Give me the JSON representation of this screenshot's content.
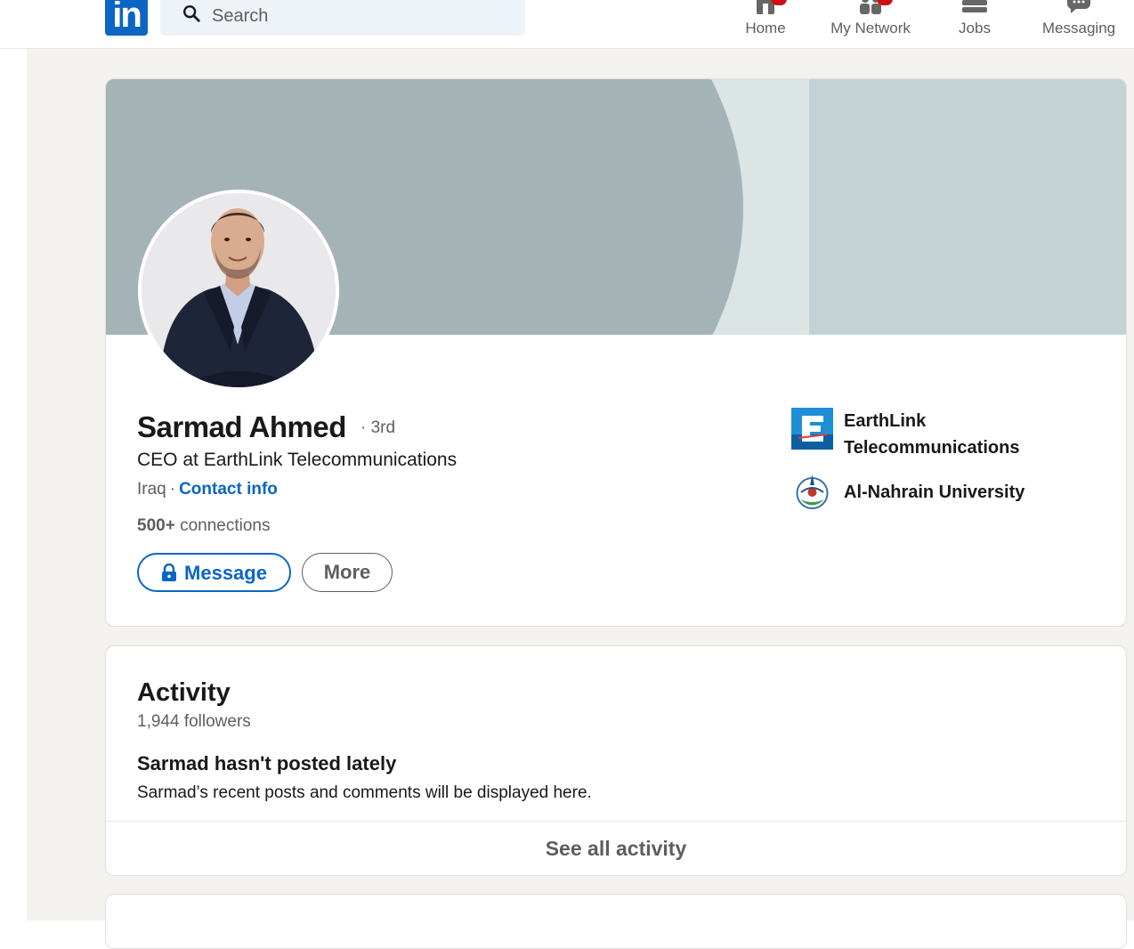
{
  "nav": {
    "logo_text": "in",
    "search_placeholder": "Search",
    "items": [
      {
        "label": "Home",
        "icon": "home-icon"
      },
      {
        "label": "My Network",
        "icon": "network-icon"
      },
      {
        "label": "Jobs",
        "icon": "briefcase-icon"
      },
      {
        "label": "Messaging",
        "icon": "chat-icon"
      }
    ]
  },
  "profile": {
    "name": "Sarmad Ahmed",
    "degree": "· 3rd",
    "headline": "CEO at EarthLink Telecommunications",
    "location": "Iraq",
    "separator": "·",
    "contact_info": "Contact info",
    "connections_count": "500+",
    "connections_label": "connections",
    "message_button": "Message",
    "more_button": "More",
    "organizations": [
      {
        "name": "EarthLink Telecommunications",
        "icon": "earthlink-logo"
      },
      {
        "name": "Al-Nahrain University",
        "icon": "al-nahrain-logo"
      }
    ]
  },
  "activity": {
    "title": "Activity",
    "followers": "1,944 followers",
    "empty_title": "Sarmad hasn't posted lately",
    "empty_desc": "Sarmad’s recent posts and comments will be displayed here.",
    "see_all": "See all activity"
  },
  "colors": {
    "brand_blue": "#0a66c2",
    "notification_red": "#cc1016",
    "page_background": "#f4f2ee"
  }
}
